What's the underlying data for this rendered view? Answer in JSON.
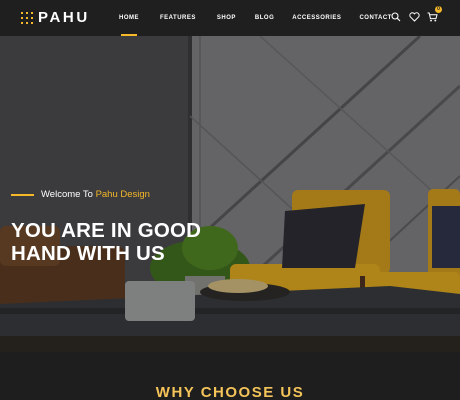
{
  "brand": {
    "name": "PAHU",
    "accent_color": "#f4b829"
  },
  "nav": [
    {
      "label": "HOME",
      "active": true
    },
    {
      "label": "FEATURES",
      "active": false
    },
    {
      "label": "SHOP",
      "active": false
    },
    {
      "label": "BLOG",
      "active": false
    },
    {
      "label": "ACCESSORIES",
      "active": false
    },
    {
      "label": "CONTACT",
      "active": false
    }
  ],
  "header_icons": [
    "search-icon",
    "heart-icon",
    "cart-icon"
  ],
  "cart": {
    "count": "0"
  },
  "hero": {
    "welcome_prefix": "Welcome To ",
    "welcome_brand": "Pahu Design",
    "title_line1": "YOU ARE IN GOOD",
    "title_line2": "HAND WITH US"
  },
  "section": {
    "title": "WHY CHOOSE US"
  }
}
